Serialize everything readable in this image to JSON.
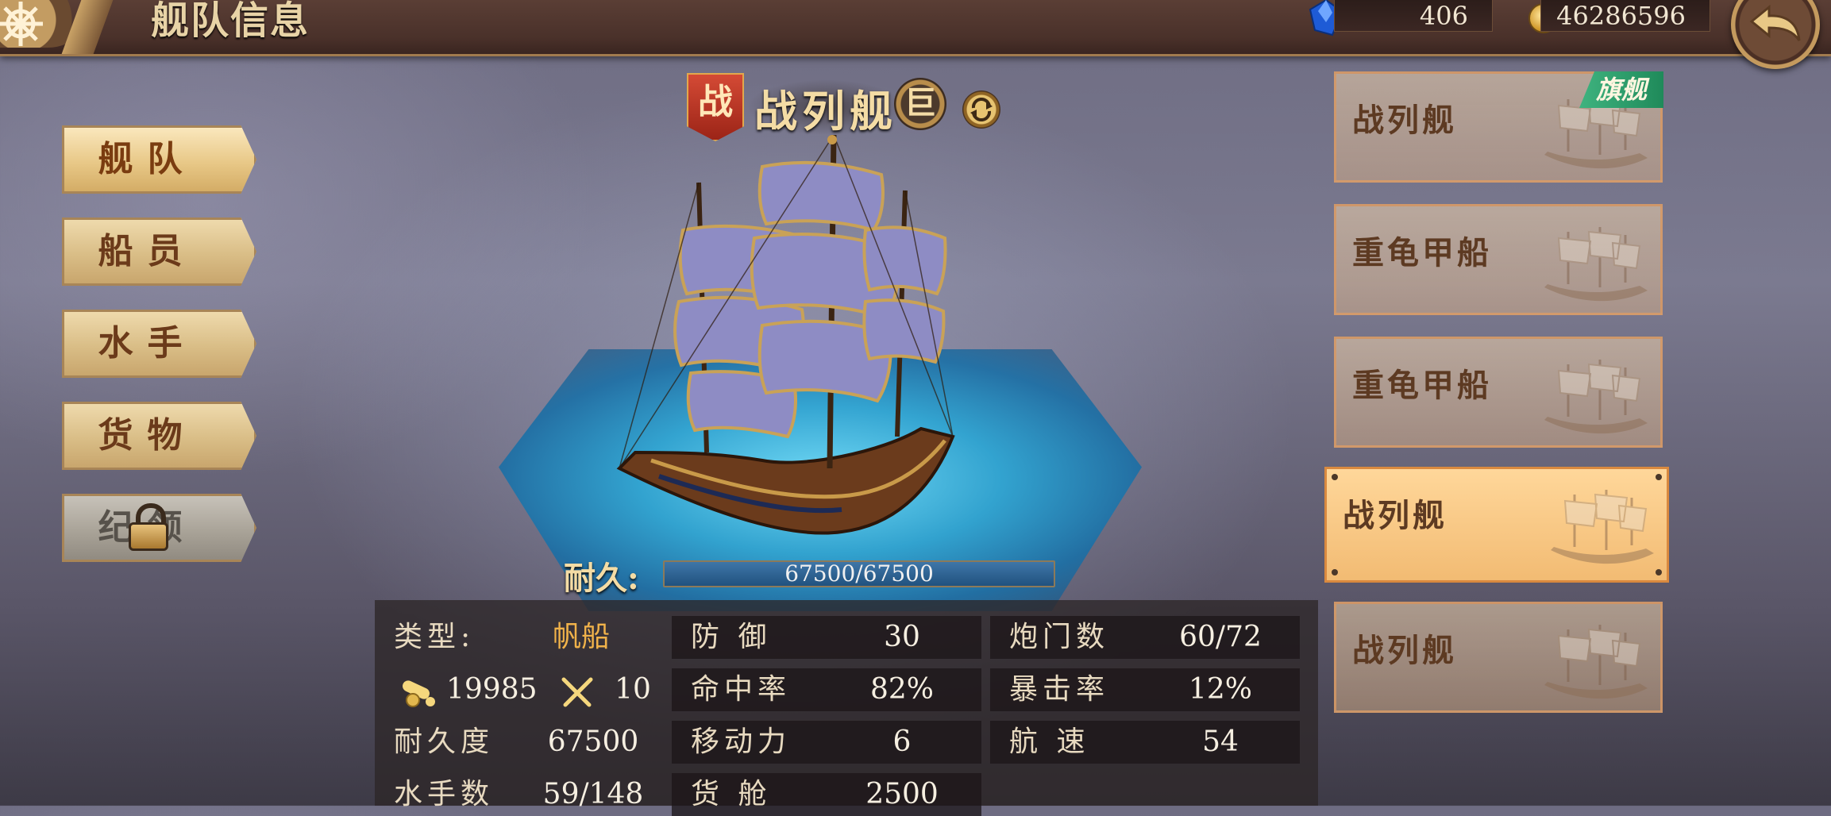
{
  "header": {
    "title": "舰队信息",
    "gems": "406",
    "coins": "46286596"
  },
  "nav": [
    {
      "label": "舰队",
      "active": true,
      "locked": false
    },
    {
      "label": "船员",
      "active": false,
      "locked": false
    },
    {
      "label": "水手",
      "active": false,
      "locked": false
    },
    {
      "label": "货物",
      "active": false,
      "locked": false
    },
    {
      "label": "纪领",
      "active": false,
      "locked": true
    }
  ],
  "ship": {
    "class_badge": "战",
    "name": "战列舰",
    "size_badge": "巨",
    "durability_label": "耐久:",
    "durability_text": "67500/67500",
    "durability_fraction": 1.0
  },
  "stats": {
    "type_label": "类型:",
    "type_value": "帆船",
    "attack_value": "19985",
    "melee_value": "10",
    "hp_label": "耐久度",
    "hp_value": "67500",
    "crew_label": "水手数",
    "crew_value": "59/148",
    "defense_label": "防 御",
    "defense_value": "30",
    "accuracy_label": "命中率",
    "accuracy_value": "82%",
    "mobility_label": "移动力",
    "mobility_value": "6",
    "cargo_label": "货 舱",
    "cargo_value": "2500",
    "cannon_label": "炮门数",
    "cannon_value": "60/72",
    "crit_label": "暴击率",
    "crit_value": "12%",
    "speed_label": "航 速",
    "speed_value": "54"
  },
  "fleet": [
    {
      "name": "战列舰",
      "tag": "旗舰",
      "active": false
    },
    {
      "name": "重龟甲船",
      "tag": "",
      "active": false
    },
    {
      "name": "重龟甲船",
      "tag": "",
      "active": false
    },
    {
      "name": "战列舰",
      "tag": "",
      "active": true
    },
    {
      "name": "战列舰",
      "tag": "",
      "active": false
    }
  ],
  "colors": {
    "accent_gold": "#f4dca5",
    "type_value": "#f0b24a",
    "flag_tag": "#2fa06c",
    "active_card": "#f2bb73"
  }
}
